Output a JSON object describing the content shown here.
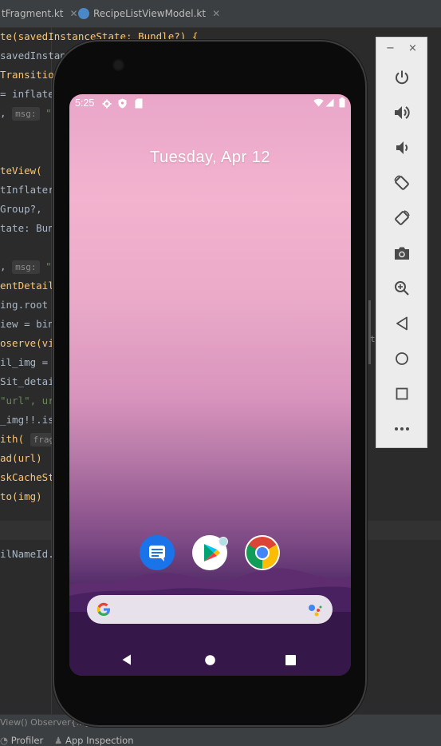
{
  "ide": {
    "tabs": [
      {
        "label": "tFragment.kt"
      },
      {
        "label": "RecipeListViewModel.kt"
      }
    ],
    "code_lines": [
      {
        "t": "te(savedInstanceState: Bundle?) {"
      },
      {
        "t": "savedInstance"
      },
      {
        "t": "Transition"
      },
      {
        "t": "= inflater"
      },
      {
        "t": ",",
        "hint": "msg:",
        "rest": "\""
      },
      {
        "t": ""
      },
      {
        "t": ""
      },
      {
        "t": "teView("
      },
      {
        "t": "tInflater,"
      },
      {
        "t": "Group?,"
      },
      {
        "t": "tate: Bundl"
      },
      {
        "t": ""
      },
      {
        "t": ",",
        "hint": "msg:",
        "rest": "\""
      },
      {
        "t": "entDetails"
      },
      {
        "t": "ing.root"
      },
      {
        "t": "iew = bind"
      },
      {
        "t": "oserve(vie"
      },
      {
        "t": "il_img = i"
      },
      {
        "t": "Sit_detail"
      },
      {
        "t": "\"url\", url"
      },
      {
        "t": "_img!!.is"
      },
      {
        "t": "ith(",
        "hint": "fragme"
      },
      {
        "t": "ad(url)"
      },
      {
        "t": "skCacheStr"
      },
      {
        "t": "to(img)"
      },
      {
        "t": ""
      },
      {
        "t": ""
      },
      {
        "t": "ilNameId."
      }
    ],
    "breadcrumb": "View()  Observer{...}",
    "bottom_tools": [
      {
        "label": "Profiler"
      },
      {
        "label": "App Inspection"
      }
    ],
    "right_marker": "t"
  },
  "phone": {
    "status_time": "5:25",
    "date": "Tuesday, Apr 12",
    "dock_apps": [
      {
        "name": "Messages",
        "color": "#1a73e8"
      },
      {
        "name": "Play Store",
        "color": "#ffffff"
      },
      {
        "name": "Chrome",
        "color": "#ffffff"
      }
    ]
  },
  "toolbar": {
    "minimize": "−",
    "close": "×",
    "items": [
      {
        "name": "power"
      },
      {
        "name": "volume-up"
      },
      {
        "name": "volume-down"
      },
      {
        "name": "rotate-left"
      },
      {
        "name": "rotate-right"
      },
      {
        "name": "screenshot"
      },
      {
        "name": "zoom"
      },
      {
        "name": "back"
      },
      {
        "name": "home"
      },
      {
        "name": "overview"
      },
      {
        "name": "more"
      }
    ]
  }
}
